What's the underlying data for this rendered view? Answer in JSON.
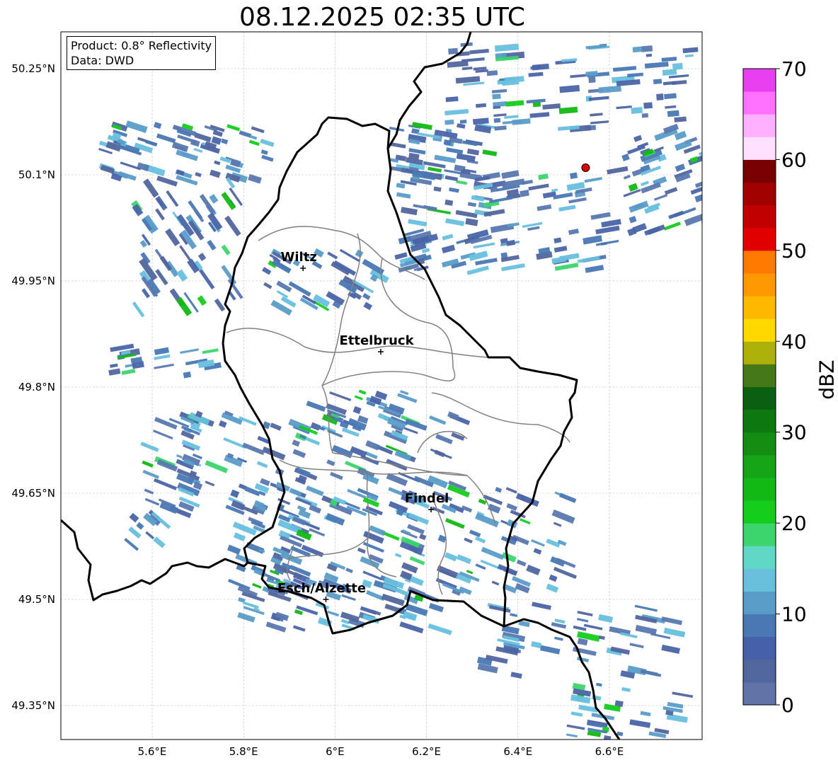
{
  "title": "08.12.2025 02:35 UTC",
  "info": {
    "product": "Product: 0.8° Reflectivity",
    "data_source": "Data: DWD"
  },
  "lat_labels": [
    "50.25°N",
    "50.1°N",
    "49.95°N",
    "49.8°N",
    "49.65°N",
    "49.5°N",
    "49.35°N"
  ],
  "lat_values": [
    50.25,
    50.1,
    49.95,
    49.8,
    49.65,
    49.5,
    49.35
  ],
  "lon_labels": [
    "5.6°E",
    "5.8°E",
    "6°E",
    "6.2°E",
    "6.4°E",
    "6.6°E"
  ],
  "lon_values": [
    5.6,
    5.8,
    6.0,
    6.2,
    6.4,
    6.6
  ],
  "cities": [
    {
      "name": "Wiltz",
      "lon": 5.93,
      "lat": 49.968
    },
    {
      "name": "Ettelbruck",
      "lon": 6.1,
      "lat": 49.85
    },
    {
      "name": "Findel",
      "lon": 6.21,
      "lat": 49.627
    },
    {
      "name": "Esch/Alzette",
      "lon": 5.98,
      "lat": 49.5
    }
  ],
  "radar_site": {
    "lon": 6.548,
    "lat": 50.11,
    "color": "#e00000"
  },
  "colorbar": {
    "label": "dBZ",
    "tick_labels": [
      "0",
      "10",
      "20",
      "30",
      "40",
      "50",
      "60",
      "70"
    ],
    "range": [
      0,
      70
    ],
    "colors": [
      "#6273a8",
      "#52669e",
      "#4360a8",
      "#4a78b4",
      "#5a9cc8",
      "#68c0de",
      "#60d8c8",
      "#3cd46c",
      "#14cc1c",
      "#12b814",
      "#14a416",
      "#128c12",
      "#0e7810",
      "#0a6010",
      "#447818",
      "#acb008",
      "#ffd800",
      "#ffb800",
      "#ff9800",
      "#ff7800",
      "#e00000",
      "#c00000",
      "#a00000",
      "#780000",
      "#ffe0ff",
      "#ffb0ff",
      "#ff70ff",
      "#e840f0"
    ]
  }
}
